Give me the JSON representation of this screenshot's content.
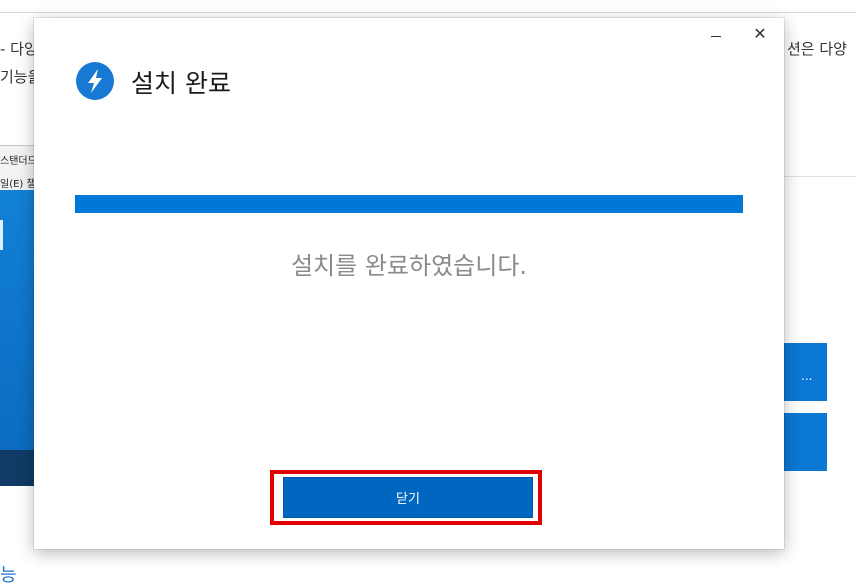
{
  "background": {
    "top_left_line1": "- 다양",
    "top_left_line2": "기능을",
    "top_right_line1": "션은 다양",
    "window_title_fragment": "스탠더드",
    "window_menu_fragment": "일(E)  챌",
    "button1_label": "...",
    "bottom_text": "능"
  },
  "dialog": {
    "title": "설치 완료",
    "minimize_symbol": "",
    "close_symbol": "✕",
    "progress_percent": 100,
    "status_message": "설치를 완료하였습니다.",
    "close_button_label": "닫기"
  },
  "colors": {
    "accent": "#0078d7",
    "highlight": "#e00000"
  }
}
